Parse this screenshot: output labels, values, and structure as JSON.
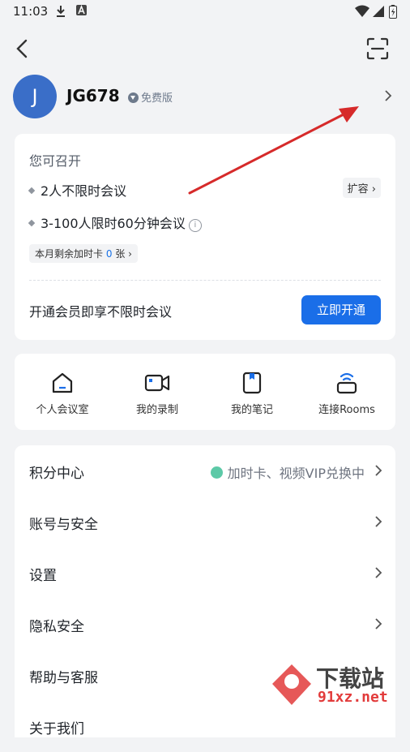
{
  "status_bar": {
    "time": "11:03"
  },
  "profile": {
    "avatar_letter": "J",
    "username": "JG678",
    "plan": "免费版"
  },
  "plan_card": {
    "title": "您可召开",
    "features": [
      "2人不限时会议",
      "3-100人限时60分钟会议"
    ],
    "expand_label": "扩容",
    "pill_prefix": "本月剩余加时卡",
    "pill_count": "0",
    "pill_suffix": "张",
    "upsell_text": "开通会员即享不限时会议",
    "open_button": "立即开通"
  },
  "quick_actions": [
    {
      "label": "个人会议室",
      "icon": "home-icon"
    },
    {
      "label": "我的录制",
      "icon": "video-icon"
    },
    {
      "label": "我的笔记",
      "icon": "note-icon"
    },
    {
      "label": "连接Rooms",
      "icon": "rooms-icon"
    }
  ],
  "menu": [
    {
      "label": "积分中心",
      "extra": "加时卡、视频VIP兑换中"
    },
    {
      "label": "账号与安全"
    },
    {
      "label": "设置"
    },
    {
      "label": "隐私安全"
    },
    {
      "label": "帮助与客服"
    },
    {
      "label": "关于我们"
    }
  ],
  "watermark": {
    "text1": "下载站",
    "text2": "91xz.net"
  },
  "colors": {
    "primary": "#1a6ee8",
    "avatar": "#3a6ec8",
    "annotation_arrow": "#d62a2a"
  }
}
